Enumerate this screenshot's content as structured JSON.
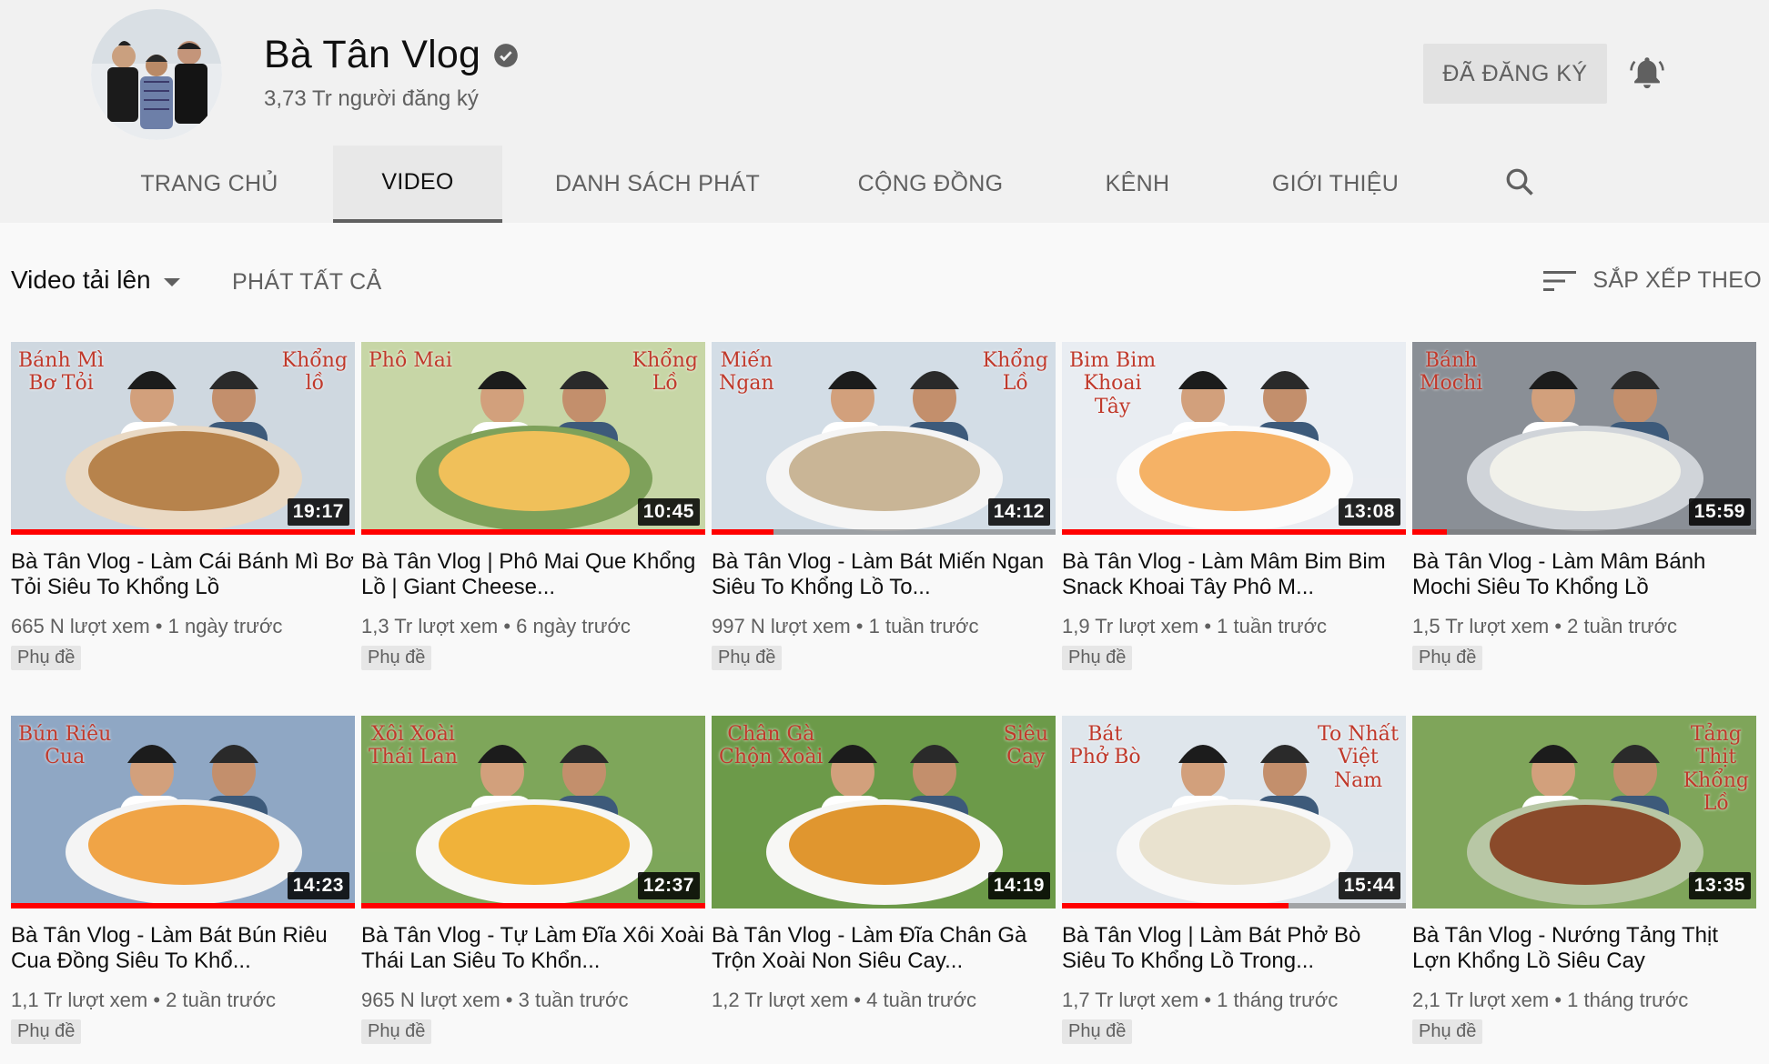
{
  "channel": {
    "name": "Bà Tân Vlog",
    "subscribers": "3,73 Tr người đăng ký",
    "subscribe_label": "ĐÃ ĐĂNG KÝ"
  },
  "tabs": [
    {
      "label": "TRANG CHỦ"
    },
    {
      "label": "VIDEO"
    },
    {
      "label": "DANH SÁCH PHÁT"
    },
    {
      "label": "CỘNG ĐỒNG"
    },
    {
      "label": "KÊNH"
    },
    {
      "label": "GIỚI THIỆU"
    }
  ],
  "filter": {
    "uploads_label": "Video tải lên",
    "play_all_label": "PHÁT TẤT CẢ",
    "sort_label": "SẮP XẾP THEO"
  },
  "icons": {
    "verified": "verified-check-icon",
    "bell": "notification-bell-icon",
    "search": "search-icon",
    "sort": "sort-icon",
    "caret": "caret-down-icon"
  },
  "colors": {
    "progress": "#ff0000",
    "background": "#f9f9f9",
    "header_bg": "#f1f1f1"
  },
  "videos": [
    {
      "title": "Bà Tân Vlog - Làm Cái Bánh Mì Bơ Tỏi Siêu To Khổng Lồ",
      "views": "665 N lượt xem",
      "age": "1 ngày trước",
      "duration": "19:17",
      "badge": "Phụ đề",
      "thumb_left": "Bánh Mì\nBơ Tỏi",
      "thumb_right": "Khổng\nlồ",
      "progress": 1.0
    },
    {
      "title": "Bà Tân Vlog | Phô Mai Que Khổng Lồ | Giant Cheese...",
      "views": "1,3 Tr lượt xem",
      "age": "6 ngày trước",
      "duration": "10:45",
      "badge": "Phụ đề",
      "thumb_left": "Phô Mai",
      "thumb_right": "Khổng\nLồ",
      "progress": 1.0
    },
    {
      "title": "Bà Tân Vlog - Làm Bát Miến Ngan Siêu To Khổng Lồ To...",
      "views": "997 N lượt xem",
      "age": "1 tuần trước",
      "duration": "14:12",
      "badge": "Phụ đề",
      "thumb_left": "Miến\nNgan",
      "thumb_right": "Khổng\nLồ",
      "progress": 0.18
    },
    {
      "title": "Bà Tân Vlog - Làm Mâm Bim Bim Snack Khoai Tây Phô M...",
      "views": "1,9 Tr lượt xem",
      "age": "1 tuần trước",
      "duration": "13:08",
      "badge": "Phụ đề",
      "thumb_left": "Bim Bim\nKhoai\nTây",
      "thumb_right": "",
      "progress": 1.0
    },
    {
      "title": "Bà Tân Vlog - Làm Mâm Bánh Mochi Siêu To Khổng Lồ",
      "views": "1,5 Tr lượt xem",
      "age": "2 tuần trước",
      "duration": "15:59",
      "badge": "Phụ đề",
      "thumb_left": "Bánh\nMochi",
      "thumb_right": "",
      "progress": 0.1
    },
    {
      "title": "Bà Tân Vlog - Làm Bát Bún Riêu Cua Đồng Siêu To Khổ...",
      "views": "1,1 Tr lượt xem",
      "age": "2 tuần trước",
      "duration": "14:23",
      "badge": "Phụ đề",
      "thumb_left": "Bún Riêu\nCua",
      "thumb_right": "",
      "progress": 1.0
    },
    {
      "title": "Bà Tân Vlog - Tự Làm Đĩa Xôi Xoài Thái Lan Siêu To Khổn...",
      "views": "965 N lượt xem",
      "age": "3 tuần trước",
      "duration": "12:37",
      "badge": "Phụ đề",
      "thumb_left": "Xôi Xoài\nThái Lan",
      "thumb_right": "",
      "progress": 1.0
    },
    {
      "title": "Bà Tân Vlog - Làm Đĩa Chân Gà Trộn Xoài Non Siêu Cay...",
      "views": "1,2 Tr lượt xem",
      "age": "4 tuần trước",
      "duration": "14:19",
      "badge": "",
      "thumb_left": "Chân Gà\nChộn Xoài",
      "thumb_right": "Siêu\nCay",
      "progress": 0
    },
    {
      "title": "Bà Tân Vlog | Làm Bát Phở Bò Siêu To Khổng Lồ Trong...",
      "views": "1,7 Tr lượt xem",
      "age": "1 tháng trước",
      "duration": "15:44",
      "badge": "Phụ đề",
      "thumb_left": "Bát\nPhở Bò",
      "thumb_right": "To Nhất\nViệt\nNam",
      "progress": 0.66
    },
    {
      "title": "Bà Tân Vlog - Nướng Tảng Thịt Lợn Khổng Lồ Siêu Cay",
      "views": "2,1 Tr lượt xem",
      "age": "1 tháng trước",
      "duration": "13:35",
      "badge": "Phụ đề",
      "thumb_left": "",
      "thumb_right": "Tảng\nThịt\nKhổng\nLồ",
      "progress": 0
    }
  ]
}
